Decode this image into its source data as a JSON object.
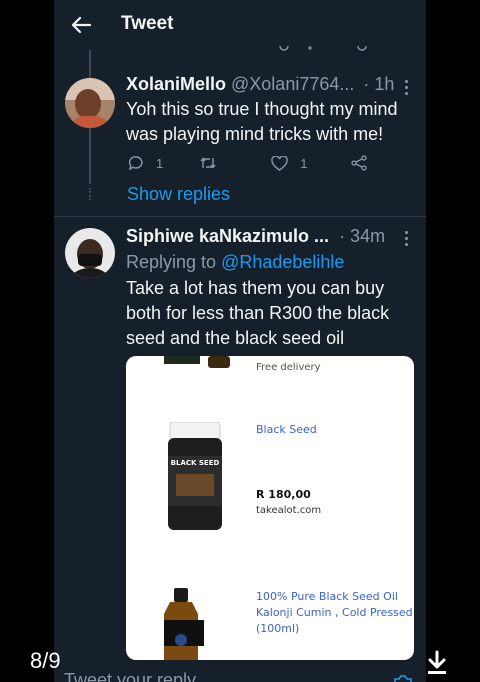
{
  "header": {
    "title": "Tweet"
  },
  "tweets": [
    {
      "name": "XolaniMello",
      "handle": "@Xolani7764...",
      "time": "· 1h",
      "text_lines": [
        "Yoh this so true I thought my mind",
        "was playing mind tricks with me!"
      ],
      "replies": "1",
      "likes": "1"
    },
    {
      "name": "Siphiwe kaNkazimulo ...",
      "time": "· 34m",
      "replying_to_label": "Replying to",
      "replying_to_user": "@Rhadebelihle",
      "text_lines": [
        "Take a lot has them you can buy",
        "both for less than R300 the black",
        "seed and the black seed oil"
      ]
    }
  ],
  "show_replies": "Show replies",
  "card": {
    "free_delivery": "Free delivery",
    "product1_name": "Black Seed",
    "product1_price": "R 180,00",
    "product1_store": "takealot.com",
    "jar_label": "BLACK SEED",
    "product2_line1": "100% Pure Black Seed Oil",
    "product2_line2": "Kalonji Cumin , Cold Pressed",
    "product2_line3": "(100ml)"
  },
  "footer": {
    "page_count": "8/9",
    "reply_placeholder": "Tweet your reply"
  },
  "colors": {
    "background": "#15202b",
    "accent": "#1d9bf0",
    "muted": "#8b98a5"
  }
}
